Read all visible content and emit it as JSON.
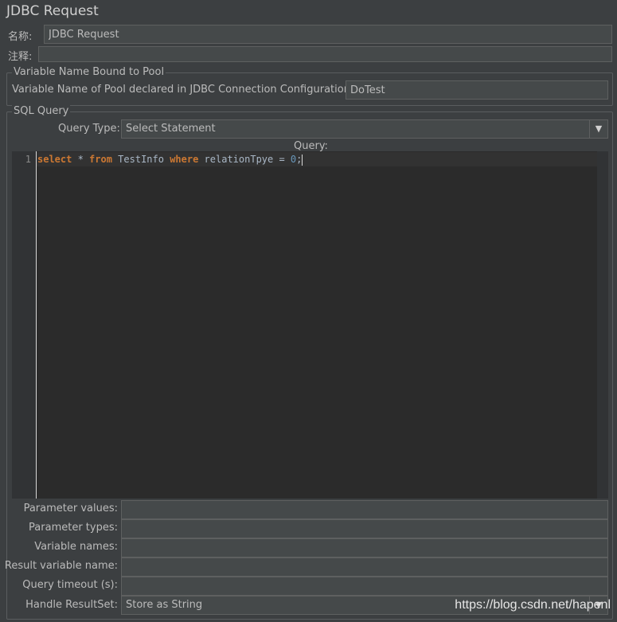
{
  "window": {
    "title": "JDBC Request"
  },
  "name_row": {
    "label": "名称:",
    "value": "JDBC Request"
  },
  "comment_row": {
    "label": "注释:",
    "value": ""
  },
  "pool_section": {
    "legend": "Variable Name Bound to Pool",
    "label": "Variable Name of Pool declared in JDBC Connection Configuration:",
    "value": "DoTest"
  },
  "sql_section": {
    "legend": "SQL Query",
    "query_type_label": "Query Type:",
    "query_type_value": "Select Statement",
    "query_label": "Query:",
    "editor": {
      "line_numbers": [
        "1"
      ],
      "tokens": {
        "t1": "select",
        "t2": " * ",
        "t3": "from",
        "t4": " TestInfo ",
        "t5": "where",
        "t6": " relationTpye = ",
        "t7": "0",
        "t8": ";"
      }
    }
  },
  "params": {
    "parameter_values_label": "Parameter values:",
    "parameter_values": "",
    "parameter_types_label": "Parameter types:",
    "parameter_types": "",
    "variable_names_label": "Variable names:",
    "variable_names": "",
    "result_variable_label": "Result variable name:",
    "result_variable": "",
    "query_timeout_label": "Query timeout (s):",
    "query_timeout": "",
    "handle_resultset_label": "Handle ResultSet:",
    "handle_resultset_value": "Store as String"
  },
  "watermark": "https://blog.csdn.net/hapenl",
  "icons": {
    "dropdown": "chevron-down-icon"
  },
  "colors": {
    "background": "#3c3f41",
    "editor_bg": "#2b2b2b",
    "keyword": "#cc7832",
    "number": "#6897bb",
    "identifier": "#a9b7c6"
  }
}
